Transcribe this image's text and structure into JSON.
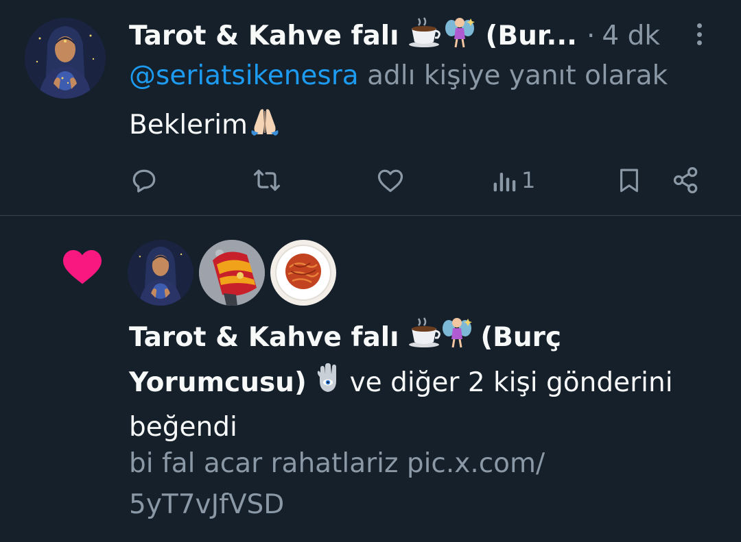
{
  "reply": {
    "display_name": "Tarot & Kahve falı",
    "display_name_suffix": "(Bur...",
    "separator": "·",
    "time": "4 dk",
    "reply_to_handle": "@seriatsikenesra",
    "reply_to_suffix": "adlı kişiye yanıt olarak",
    "text": "Beklerim",
    "actions": {
      "views_count": "1"
    }
  },
  "notification": {
    "name_line1": "Tarot & Kahve falı",
    "name_line2_part": "(Burç",
    "name_line2_end": "Yorumcusu)",
    "others_text": "ve diğer 2 kişi gönderini",
    "liked_text": "beğendi",
    "snippet_line1": "bi fal acar rahatlariz pic.x.com/",
    "snippet_line2": "5yT7vJfVSD"
  },
  "colors": {
    "background": "#15202b",
    "text_primary": "#f7f9f9",
    "text_secondary": "#8b98a5",
    "accent_link": "#1d9bf0",
    "like_pink": "#f91880",
    "divider": "#38444d"
  },
  "icons": {
    "reply": "reply-icon",
    "retweet": "retweet-icon",
    "like": "heart-icon",
    "views": "views-icon",
    "bookmark": "bookmark-icon",
    "share": "share-icon",
    "more": "more-icon",
    "notification_like": "heart-filled-icon"
  }
}
